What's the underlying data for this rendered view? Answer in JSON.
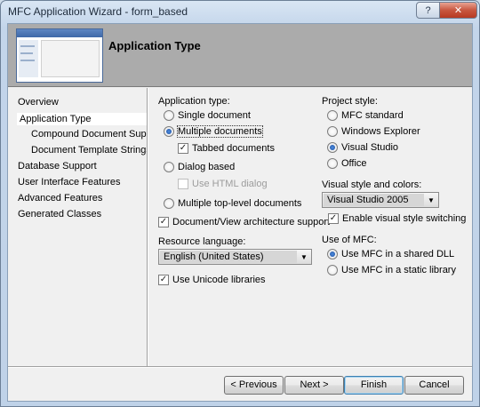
{
  "window": {
    "title": "MFC Application Wizard - form_based",
    "help_label": "?",
    "close_label": "✕"
  },
  "banner": {
    "title": "Application Type"
  },
  "sidebar": {
    "items": [
      {
        "label": "Overview"
      },
      {
        "label": "Application Type"
      },
      {
        "label": "Compound Document Support"
      },
      {
        "label": "Document Template Strings"
      },
      {
        "label": "Database Support"
      },
      {
        "label": "User Interface Features"
      },
      {
        "label": "Advanced Features"
      },
      {
        "label": "Generated Classes"
      }
    ],
    "selected": "Application Type"
  },
  "app_type": {
    "heading": "Application type:",
    "single_document": "Single document",
    "multiple_documents": "Multiple documents",
    "tabbed_documents": "Tabbed documents",
    "dialog_based": "Dialog based",
    "use_html_dialog": "Use HTML dialog",
    "multiple_top_level": "Multiple top-level documents",
    "doc_view_support": "Document/View architecture support",
    "resource_language_label": "Resource language:",
    "resource_language_value": "English (United States)",
    "use_unicode": "Use Unicode libraries",
    "selected": "Multiple documents",
    "checked": {
      "tabbed_documents": true,
      "use_html_dialog": false,
      "doc_view_support": true,
      "use_unicode": true
    }
  },
  "project_style": {
    "heading": "Project style:",
    "mfc_standard": "MFC standard",
    "windows_explorer": "Windows Explorer",
    "visual_studio": "Visual Studio",
    "office": "Office",
    "selected": "Visual Studio",
    "visual_style_label": "Visual style and colors:",
    "visual_style_value": "Visual Studio 2005",
    "enable_visual_style_switching": "Enable visual style switching",
    "enable_visual_style_checked": true
  },
  "use_of_mfc": {
    "heading": "Use of MFC:",
    "shared_dll": "Use MFC in a shared DLL",
    "static_library": "Use MFC in a static library",
    "selected": "Use MFC in a shared DLL"
  },
  "buttons": {
    "previous": "< Previous",
    "next": "Next >",
    "finish": "Finish",
    "cancel": "Cancel"
  },
  "icons": {
    "check_glyph": "✓",
    "dropdown_glyph": "▼"
  }
}
